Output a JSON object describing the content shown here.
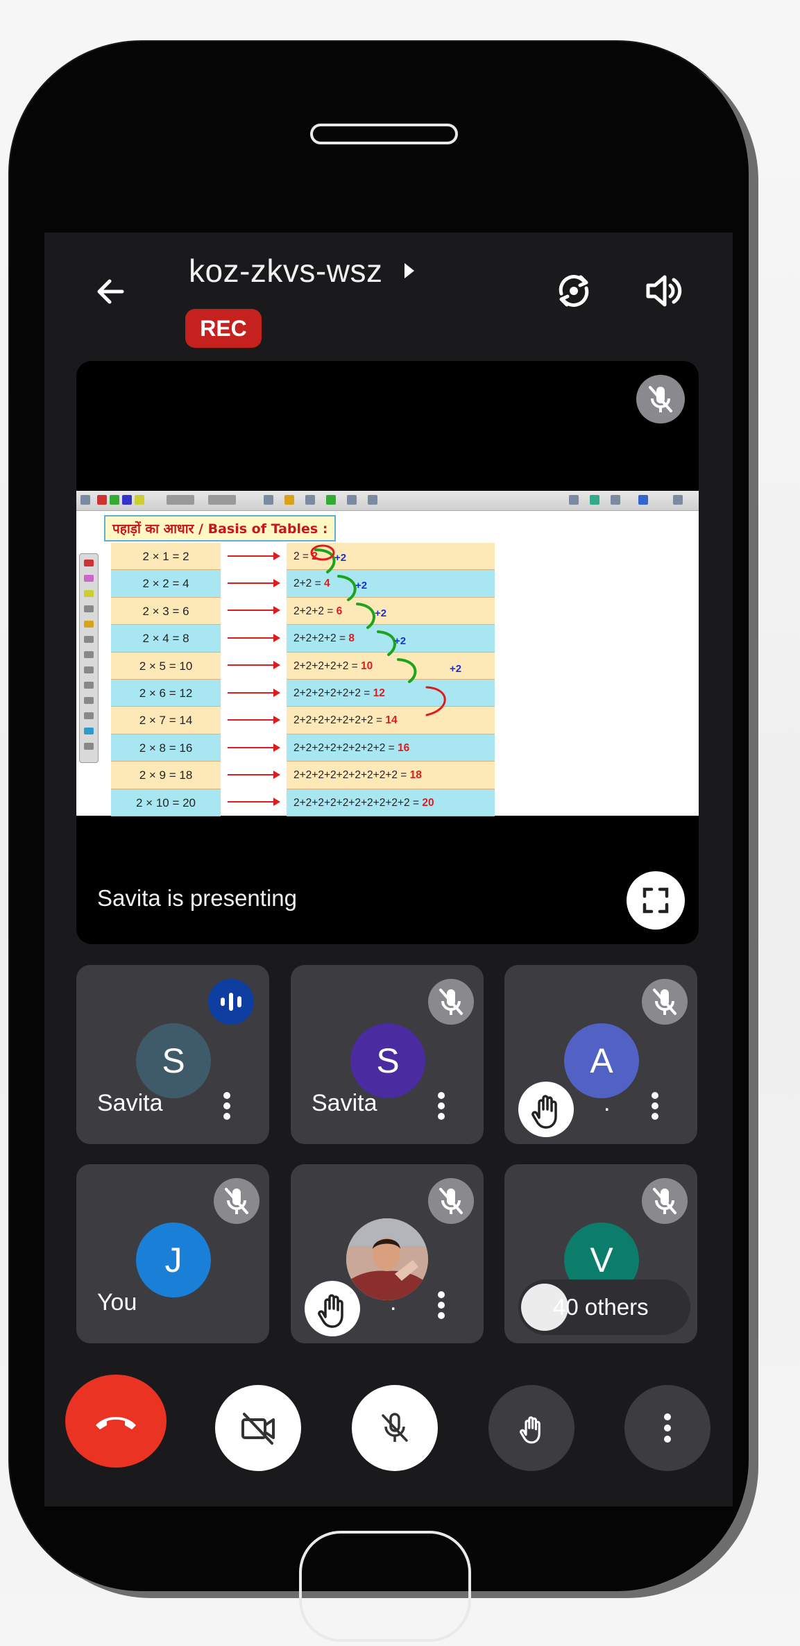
{
  "meeting": {
    "code": "koz-zkvs-wsz",
    "rec_label": "REC"
  },
  "presentation": {
    "status_text": "Savita is presenting",
    "slide": {
      "title": "पहाड़ों का आधार / Basis of Tables :",
      "left_column": [
        "2 × 1 = 2",
        "2 × 2 = 4",
        "2 × 3 = 6",
        "2 × 4 = 8",
        "2 × 5 = 10",
        "2 × 6 = 12",
        "2 × 7 = 14",
        "2 × 8 = 16",
        "2 × 9 = 18",
        "2 × 10 = 20"
      ],
      "right_column": [
        {
          "expr": "2 = ",
          "result": "2"
        },
        {
          "expr": "2+2 = ",
          "result": "4"
        },
        {
          "expr": "2+2+2 = ",
          "result": "6"
        },
        {
          "expr": "2+2+2+2 = ",
          "result": "8"
        },
        {
          "expr": "2+2+2+2+2 = ",
          "result": "10"
        },
        {
          "expr": "2+2+2+2+2+2 = ",
          "result": "12"
        },
        {
          "expr": "2+2+2+2+2+2+2 = ",
          "result": "14"
        },
        {
          "expr": "2+2+2+2+2+2+2+2 = ",
          "result": "16"
        },
        {
          "expr": "2+2+2+2+2+2+2+2+2 = ",
          "result": "18"
        },
        {
          "expr": "2+2+2+2+2+2+2+2+2+2 = ",
          "result": "20"
        }
      ],
      "step_label": "+2"
    }
  },
  "participants": [
    {
      "name": "Savita",
      "initial": "S",
      "color": "#3f5a68",
      "state": "speaking"
    },
    {
      "name": "Savita",
      "initial": "S",
      "color": "#4a2ca0",
      "state": "muted"
    },
    {
      "name": ".",
      "initial": "A",
      "color": "#5161c4",
      "state": "muted",
      "hand_raised": true
    },
    {
      "name": "You",
      "initial": "J",
      "color": "#1a7fd6",
      "state": "muted"
    },
    {
      "name": ".",
      "initial": "",
      "state": "muted",
      "hand_raised": true,
      "photo": true
    },
    {
      "name": "",
      "initial": "V",
      "color": "#0d7d6b",
      "state": "muted"
    }
  ],
  "others_label": "40 others",
  "controls": {
    "end_call_color": "#ea3323",
    "camera": "camera-off-icon",
    "mic": "mic-off-icon",
    "hand": "raise-hand-icon",
    "more": "more-options-icon"
  }
}
